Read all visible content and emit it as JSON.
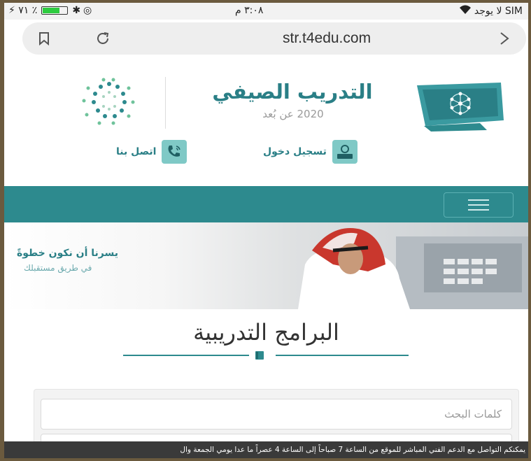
{
  "status_bar": {
    "left_text": "⚡ ٧١ ٪",
    "bt_icon": "bluetooth-icon",
    "sync_icon": "sync-icon",
    "time": "٣:٠٨ م",
    "carrier": "لا يوجد SIM",
    "wifi_icon": "wifi-icon",
    "battery_level": 0.71
  },
  "browser": {
    "url": "str.t4edu.com",
    "bookmark_icon": "bookmark-icon",
    "reload_icon": "reload-icon",
    "forward_icon": "forward-arrow-icon"
  },
  "header": {
    "title": "التدريب الصيفي",
    "subtitle": "2020 عن بُعد",
    "login_label": "تسجيل دخول",
    "contact_label": "اتصل بنا"
  },
  "banner": {
    "line1": "يسرنا أن نكون خطوةً",
    "line2": "في طريق مستقبلك"
  },
  "section": {
    "title": "البرامج التدريبية"
  },
  "search": {
    "placeholder": "كلمات البحث"
  },
  "ticker": {
    "text": "يمكنكم التواصل مع الدعم الفني المباشر للموقع من الساعة 7 صباحاً إلى الساعة 4 عصراً ما عدا يومي الجمعة وال"
  },
  "colors": {
    "accent": "#2d8a8e",
    "nav_bg": "#2d8a8e",
    "ticker_bg": "#3a3a3a"
  }
}
